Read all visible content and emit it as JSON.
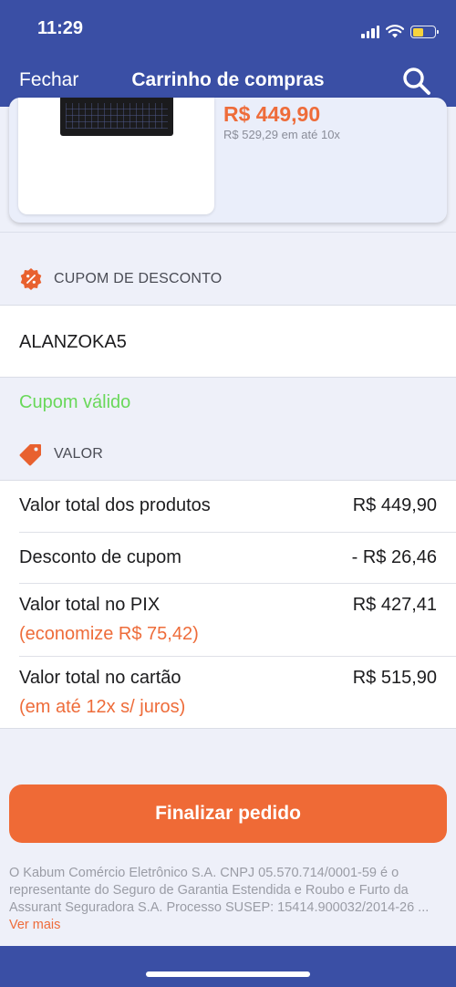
{
  "status_bar": {
    "time": "11:29"
  },
  "nav": {
    "close_label": "Fechar",
    "title": "Carrinho de compras",
    "search_icon": "search-icon"
  },
  "product": {
    "price": "R$ 449,90",
    "installments": "R$ 529,29 em até 10x"
  },
  "coupon": {
    "heading": "CUPOM DE DESCONTO",
    "value": "ALANZOKA5",
    "status": "Cupom válido"
  },
  "values": {
    "heading": "VALOR",
    "rows": [
      {
        "label": "Valor total dos produtos",
        "value": "R$ 449,90"
      },
      {
        "label": "Desconto de cupom",
        "value": "- R$ 26,46"
      },
      {
        "label": "Valor total no PIX",
        "value": "R$ 427,41",
        "note": "(economize R$ 75,42)"
      },
      {
        "label": "Valor total no cartão",
        "value": "R$ 515,90",
        "note": "(em até 12x s/ juros)"
      }
    ]
  },
  "cta": {
    "label": "Finalizar pedido"
  },
  "legal": {
    "text": "O Kabum Comércio Eletrônico S.A. CNPJ 05.570.714/0001-59 é o representante do Seguro de Garantia Estendida e Roubo e Furto da Assurant Seguradora S.A. Processo SUSEP: 15414.900032/2014-26 ...",
    "more": "Ver mais"
  },
  "colors": {
    "brand": "#3a4fa5",
    "accent": "#ef6a36",
    "valid": "#69d85a"
  }
}
